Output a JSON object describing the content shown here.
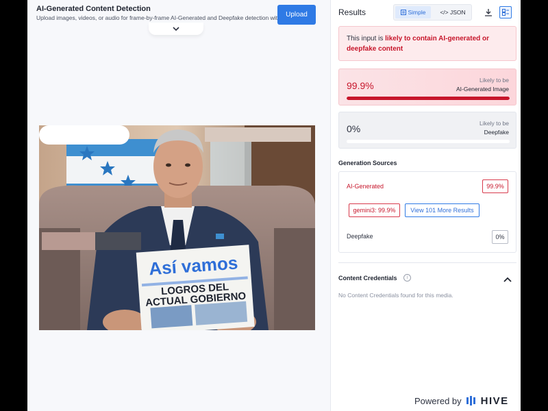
{
  "header": {
    "title": "AI-Generated Content Detection",
    "subtitle": "Upload images, videos, or audio for frame-by-frame AI-Generated and Deepfake detection with...",
    "upload_label": "Upload"
  },
  "image": {
    "newspaper_headline": "Así vamos",
    "newspaper_subhead_1": "LOGROS DEL",
    "newspaper_subhead_2": "ACTUAL GOBIERNO"
  },
  "results": {
    "title": "Results",
    "view_simple": "Simple",
    "view_json": "</> JSON",
    "alert_prefix": "This input is ",
    "alert_highlight": "likely to contain AI-generated or deepfake content",
    "ai_score": {
      "value": "99.9%",
      "label_small": "Likely to be",
      "label_big": "AI-Generated Image",
      "fill_percent": 99.9
    },
    "deepfake_score": {
      "value": "0%",
      "label_small": "Likely to be",
      "label_big": "Deepfake",
      "fill_percent": 0
    }
  },
  "generation_sources": {
    "title": "Generation Sources",
    "ai_label": "AI-Generated",
    "ai_value": "99.9%",
    "model_tag": "gemini3: 99.9%",
    "more_results": "View 101 More Results",
    "deepfake_label": "Deepfake",
    "deepfake_value": "0%"
  },
  "content_credentials": {
    "title": "Content Credentials",
    "info_symbol": "i",
    "empty_text": "No Content Credentials found for this media."
  },
  "footer": {
    "powered_by": "Powered by",
    "brand": "HIVE"
  },
  "colors": {
    "accent_blue": "#2f7ae5",
    "alert_red": "#c7162b",
    "alert_bg": "#fdebed"
  },
  "icons": [
    "chevron-down-icon",
    "simple-view-icon",
    "download-icon",
    "layout-icon",
    "info-icon",
    "chevron-up-icon",
    "hive-logo-icon"
  ]
}
